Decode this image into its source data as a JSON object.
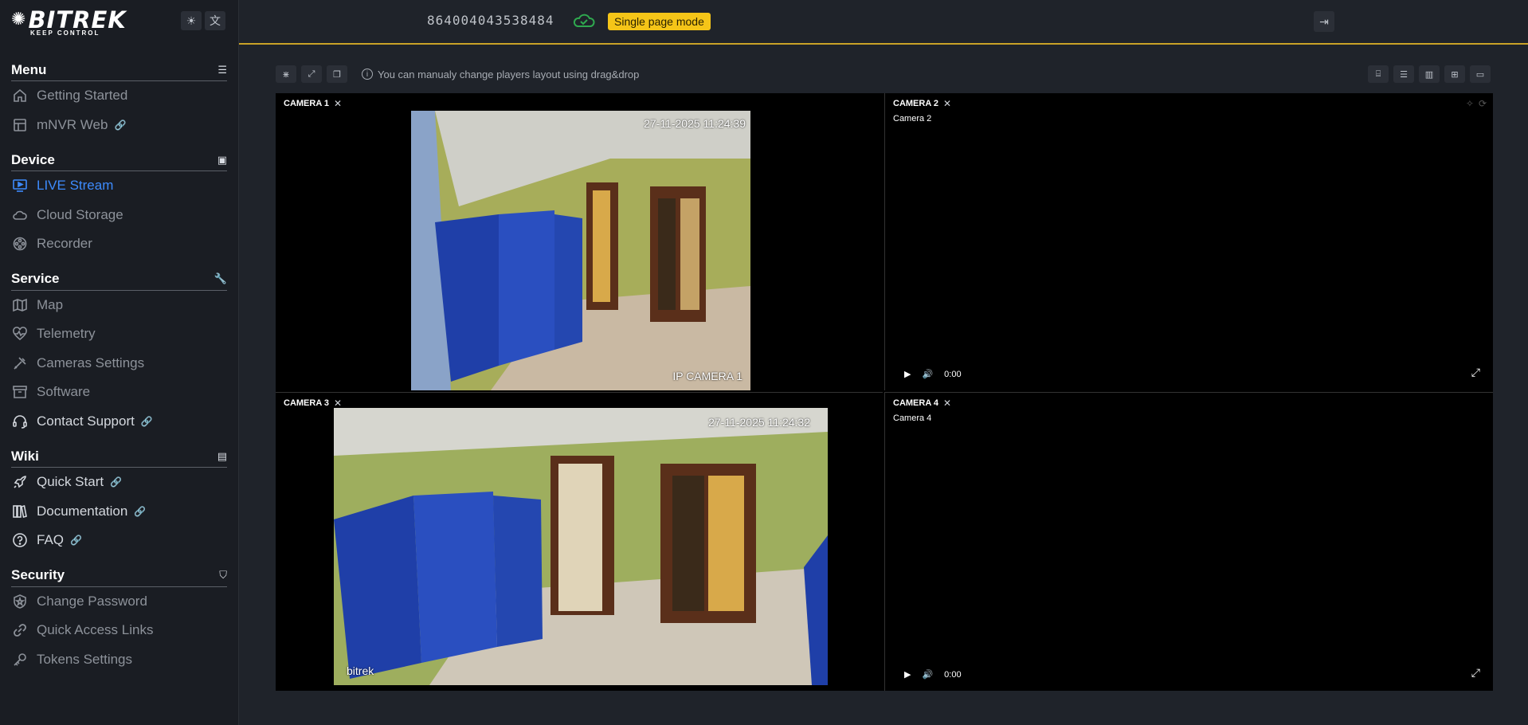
{
  "brand": {
    "logo_main": "BITREK",
    "logo_sub": "KEEP CONTROL"
  },
  "header": {
    "device_id": "864004043538484",
    "mode_badge": "Single page mode"
  },
  "sidebar": {
    "sections": [
      {
        "title": "Menu",
        "icon": "hamburger-icon",
        "items": [
          {
            "label": "Getting Started",
            "icon": "home-icon"
          },
          {
            "label": "mNVR Web",
            "icon": "layout-icon",
            "link": true
          }
        ]
      },
      {
        "title": "Device",
        "icon": "chip-icon",
        "items": [
          {
            "label": "LIVE Stream",
            "icon": "play-screen-icon",
            "active": true
          },
          {
            "label": "Cloud Storage",
            "icon": "cloud-icon"
          },
          {
            "label": "Recorder",
            "icon": "reel-icon"
          }
        ]
      },
      {
        "title": "Service",
        "icon": "wrench-icon",
        "items": [
          {
            "label": "Map",
            "icon": "map-icon"
          },
          {
            "label": "Telemetry",
            "icon": "heart-pulse-icon"
          },
          {
            "label": "Cameras Settings",
            "icon": "tools-icon"
          },
          {
            "label": "Software",
            "icon": "archive-icon"
          },
          {
            "label": "Contact Support",
            "icon": "headset-icon",
            "link": true,
            "bright": true
          }
        ]
      },
      {
        "title": "Wiki",
        "icon": "book-icon",
        "items": [
          {
            "label": "Quick Start",
            "icon": "rocket-icon",
            "link": true,
            "bright": true
          },
          {
            "label": "Documentation",
            "icon": "books-icon",
            "link": true,
            "bright": true
          },
          {
            "label": "FAQ",
            "icon": "question-icon",
            "link": true,
            "bright": true
          }
        ]
      },
      {
        "title": "Security",
        "icon": "shield-icon",
        "items": [
          {
            "label": "Change Password",
            "icon": "shield-star-icon"
          },
          {
            "label": "Quick Access Links",
            "icon": "link-icon"
          },
          {
            "label": "Tokens Settings",
            "icon": "key-icon"
          }
        ]
      }
    ]
  },
  "toolbar": {
    "hint": "You can manualy change players layout using drag&drop"
  },
  "cameras": [
    {
      "label": "CAMERA 1",
      "overlay_time": "27-11-2025 11:24:39",
      "overlay_name": "IP CAMERA 1"
    },
    {
      "label": "CAMERA 2",
      "name": "Camera 2",
      "time": "0:00"
    },
    {
      "label": "CAMERA 3",
      "overlay_time": "27-11-2025 11:24:32",
      "overlay_name": "bitrek"
    },
    {
      "label": "CAMERA 4",
      "name": "Camera 4",
      "time": "0:00"
    }
  ],
  "colors": {
    "accent": "#3d8bfd",
    "badge": "#f5c518",
    "header_line": "#c9a227"
  }
}
